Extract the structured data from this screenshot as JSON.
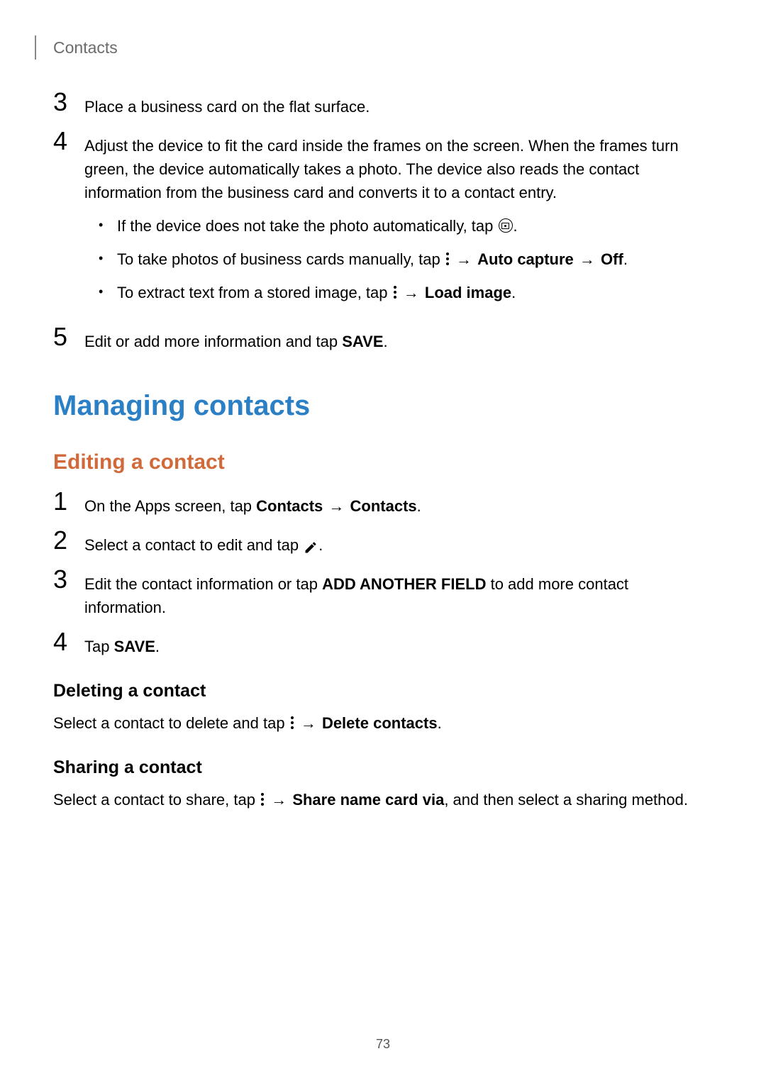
{
  "header": {
    "title": "Contacts"
  },
  "stepsA": [
    {
      "number": "3",
      "text": "Place a business card on the flat surface."
    },
    {
      "number": "4",
      "text": "Adjust the device to fit the card inside the frames on the screen. When the frames turn green, the device automatically takes a photo. The device also reads the contact information from the business card and converts it to a contact entry.",
      "bullets": [
        {
          "prefix": "If the device does not take the photo automatically, tap ",
          "suffix": "."
        },
        {
          "prefix": "To take photos of business cards manually, tap ",
          "arrow": "→",
          "bold1": "Auto capture",
          "arrow2": "→",
          "bold2": "Off",
          "suffix": "."
        },
        {
          "prefix": "To extract text from a stored image, tap ",
          "arrow": "→",
          "bold1": "Load image",
          "suffix": "."
        }
      ]
    },
    {
      "number": "5",
      "text_prefix": "Edit or add more information and tap ",
      "bold": "SAVE",
      "suffix": "."
    }
  ],
  "sectionTitle": "Managing contacts",
  "editing": {
    "title": "Editing a contact",
    "steps": [
      {
        "number": "1",
        "prefix": "On the Apps screen, tap ",
        "bold1": "Contacts",
        "arrow": "→",
        "bold2": "Contacts",
        "suffix": "."
      },
      {
        "number": "2",
        "prefix": "Select a contact to edit and tap ",
        "suffix": "."
      },
      {
        "number": "3",
        "prefix": "Edit the contact information or tap ",
        "bold1": "ADD ANOTHER FIELD",
        "suffix": " to add more contact information."
      },
      {
        "number": "4",
        "prefix": "Tap ",
        "bold1": "SAVE",
        "suffix": "."
      }
    ]
  },
  "deleting": {
    "title": "Deleting a contact",
    "prefix": "Select a contact to delete and tap ",
    "arrow": "→",
    "bold": "Delete contacts",
    "suffix": "."
  },
  "sharing": {
    "title": "Sharing a contact",
    "prefix": "Select a contact to share, tap ",
    "arrow": "→",
    "bold": "Share name card via",
    "suffix": ", and then select a sharing method."
  },
  "pageNumber": "73"
}
